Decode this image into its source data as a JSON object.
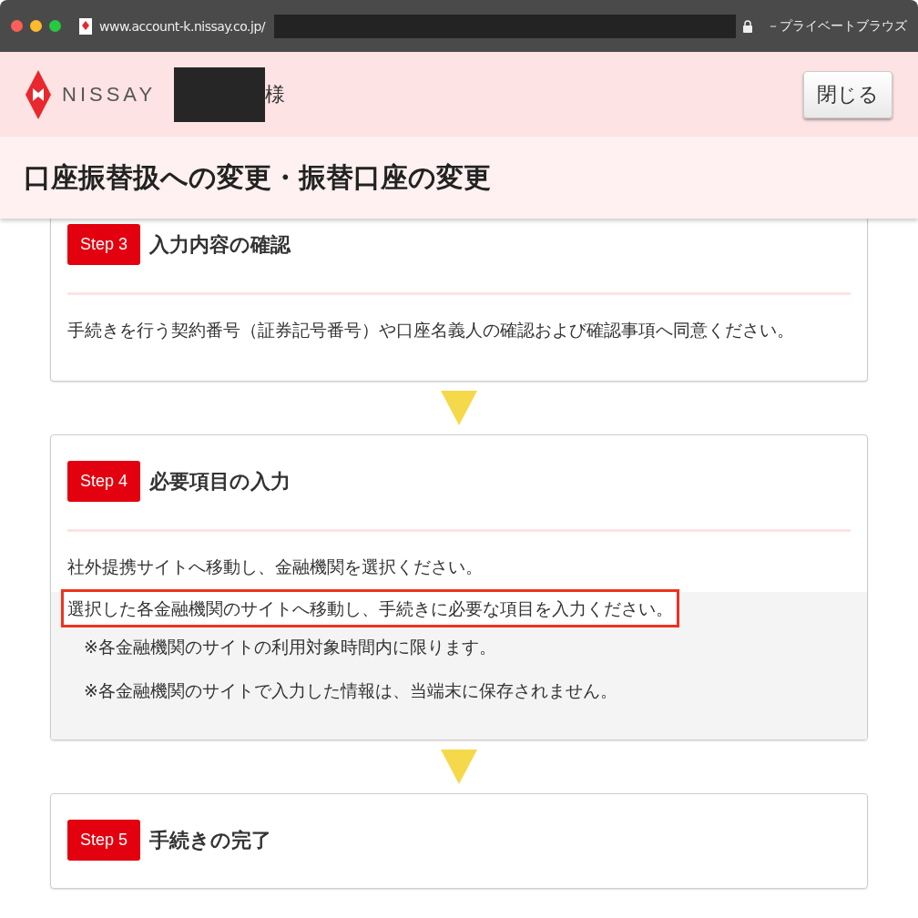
{
  "browser": {
    "url": "www.account-k.nissay.co.jp/",
    "mode": "－プライベートブラウズ"
  },
  "header": {
    "logo": "NISSAY",
    "honorific": "様",
    "close_button": "閉じる"
  },
  "title": "口座振替扱への変更・振替口座の変更",
  "steps": [
    {
      "badge": "Step 3",
      "heading": "入力内容の確認",
      "cut_top": true,
      "lines": [
        {
          "text": "手続きを行う契約番号（証券記号番号）や口座名義人の確認および確認事項へ同意ください。",
          "kind": "plain",
          "highlighted": false
        }
      ]
    },
    {
      "badge": "Step 4",
      "heading": "必要項目の入力",
      "cut_top": false,
      "lines": [
        {
          "text": "社外提携サイトへ移動し、金融機関を選択ください。",
          "kind": "plain",
          "highlighted": false
        },
        {
          "text": "選択した各金融機関のサイトへ移動し、手続きに必要な項目を入力ください。",
          "kind": "shaded",
          "highlighted": true
        },
        {
          "text": "※各金融機関のサイトの利用対象時間内に限ります。",
          "kind": "note",
          "highlighted": false
        },
        {
          "text": "※各金融機関のサイトで入力した情報は、当端末に保存されません。",
          "kind": "note",
          "highlighted": false
        }
      ]
    },
    {
      "badge": "Step 5",
      "heading": "手続きの完了",
      "cut_top": false
    }
  ]
}
